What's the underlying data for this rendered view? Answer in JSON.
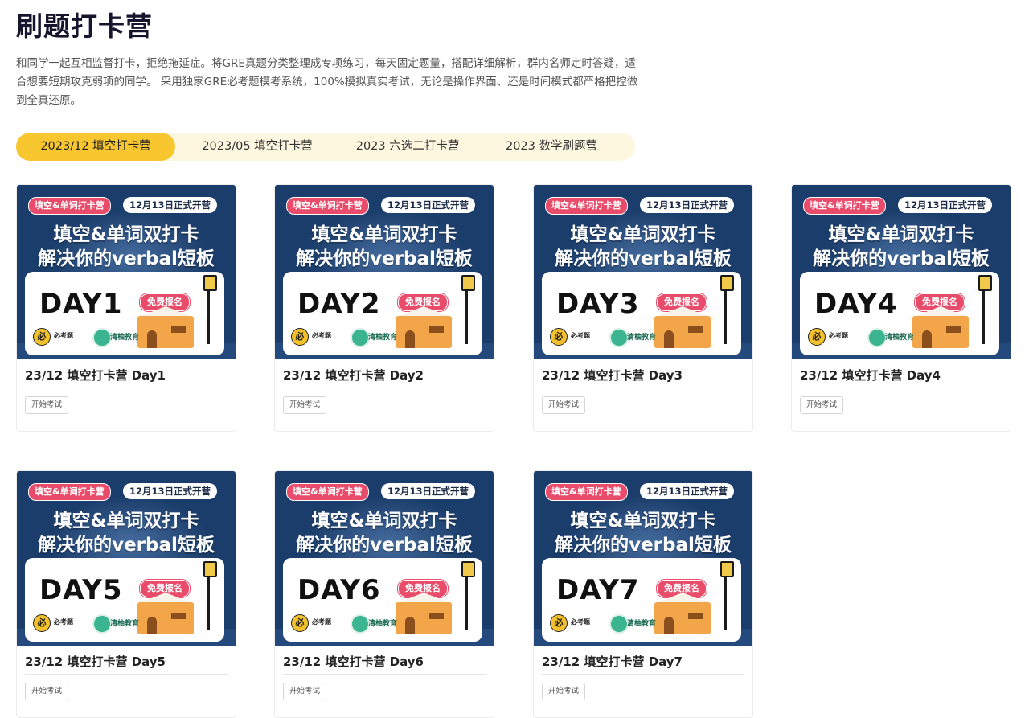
{
  "page": {
    "title": "刷题打卡营",
    "description": "和同学一起互相监督打卡，拒绝拖延症。将GRE真题分类整理成专项练习，每天固定题量，搭配详细解析，群内名师定时答疑，适合想要短期攻克弱项的同学。 采用独家GRE必考题模考系统，100%模拟真实考试，无论是操作界面、还是时间模式都严格把控做到全真还原。"
  },
  "tabs": [
    {
      "label": "2023/12 填空打卡营",
      "active": true
    },
    {
      "label": "2023/05 填空打卡营",
      "active": false
    },
    {
      "label": "2023 六选二打卡营",
      "active": false
    },
    {
      "label": "2023 数学刷题营",
      "active": false
    }
  ],
  "banner": {
    "tag_left": "填空&单词打卡营",
    "tag_right": "12月13日正式开营",
    "headline_1": "填空&单词双打卡",
    "headline_2": "解决你的verbal短板",
    "free_badge": "免费报名",
    "logo_1_mark": "必",
    "logo_1_text": "必考题",
    "logo_2_text": "清柚教育"
  },
  "cards": [
    {
      "day": "DAY1",
      "title": "23/12 填空打卡营 Day1",
      "button": "开始考试"
    },
    {
      "day": "DAY2",
      "title": "23/12 填空打卡营 Day2",
      "button": "开始考试"
    },
    {
      "day": "DAY3",
      "title": "23/12 填空打卡营 Day3",
      "button": "开始考试"
    },
    {
      "day": "DAY4",
      "title": "23/12 填空打卡营 Day4",
      "button": "开始考试"
    },
    {
      "day": "DAY5",
      "title": "23/12 填空打卡营 Day5",
      "button": "开始考试"
    },
    {
      "day": "DAY6",
      "title": "23/12 填空打卡营 Day6",
      "button": "开始考试"
    },
    {
      "day": "DAY7",
      "title": "23/12 填空打卡营 Day7",
      "button": "开始考试"
    }
  ],
  "colors": {
    "accent": "#f8c62e",
    "tab_bg": "#fef7df",
    "banner_bg": "#1b3d6b",
    "badge_red": "#e94b6b"
  }
}
